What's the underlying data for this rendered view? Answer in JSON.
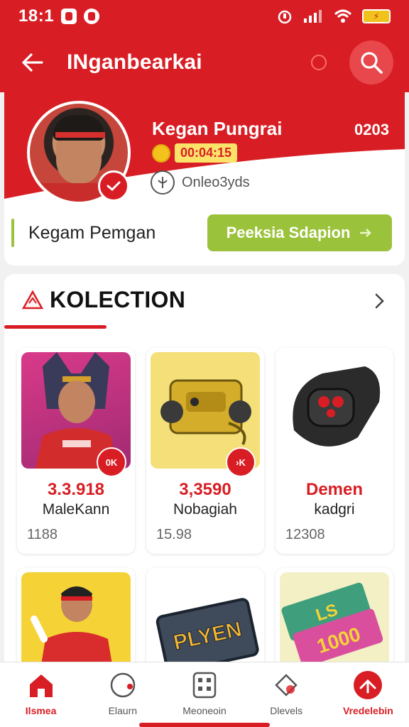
{
  "status_bar": {
    "time": "18:1"
  },
  "app_bar": {
    "title": "INganbearkai"
  },
  "profile": {
    "display_name": "Kegan Pungrai",
    "count": "0203",
    "coins": "00:04:15",
    "handle": "Onleo3yds",
    "real_name": "Kegam Pemgan",
    "action_label": "Peeksia Sdapion"
  },
  "collection": {
    "title": "KOLECTION",
    "items": [
      {
        "price": "3.3.918",
        "name": "MaleKann",
        "meta": "1188",
        "badge": "0K",
        "price_color": "#d81e24"
      },
      {
        "price": "3,3590",
        "name": "Nobagiah",
        "meta": "15.98",
        "badge": "›K",
        "price_color": "#d81e24"
      },
      {
        "price": "Demen",
        "name": "kadgri",
        "meta": "12308",
        "badge": "",
        "price_color": "#d81e24"
      }
    ],
    "lower_items": [
      {
        "name": "player-card"
      },
      {
        "name": "PLAYEN"
      },
      {
        "name": "LS 1000"
      }
    ]
  },
  "bottom_nav": {
    "items": [
      {
        "label": "Ilsmea",
        "icon": "home-icon"
      },
      {
        "label": "Elaurn",
        "icon": "circle-icon"
      },
      {
        "label": "Meoneoin",
        "icon": "grid-icon"
      },
      {
        "label": "Dlevels",
        "icon": "tag-icon"
      },
      {
        "label": "Vredelebin",
        "icon": "profile-icon"
      }
    ]
  },
  "colors": {
    "accent": "#d81e24",
    "action": "#9bc23b",
    "coin": "#f3c21d"
  }
}
